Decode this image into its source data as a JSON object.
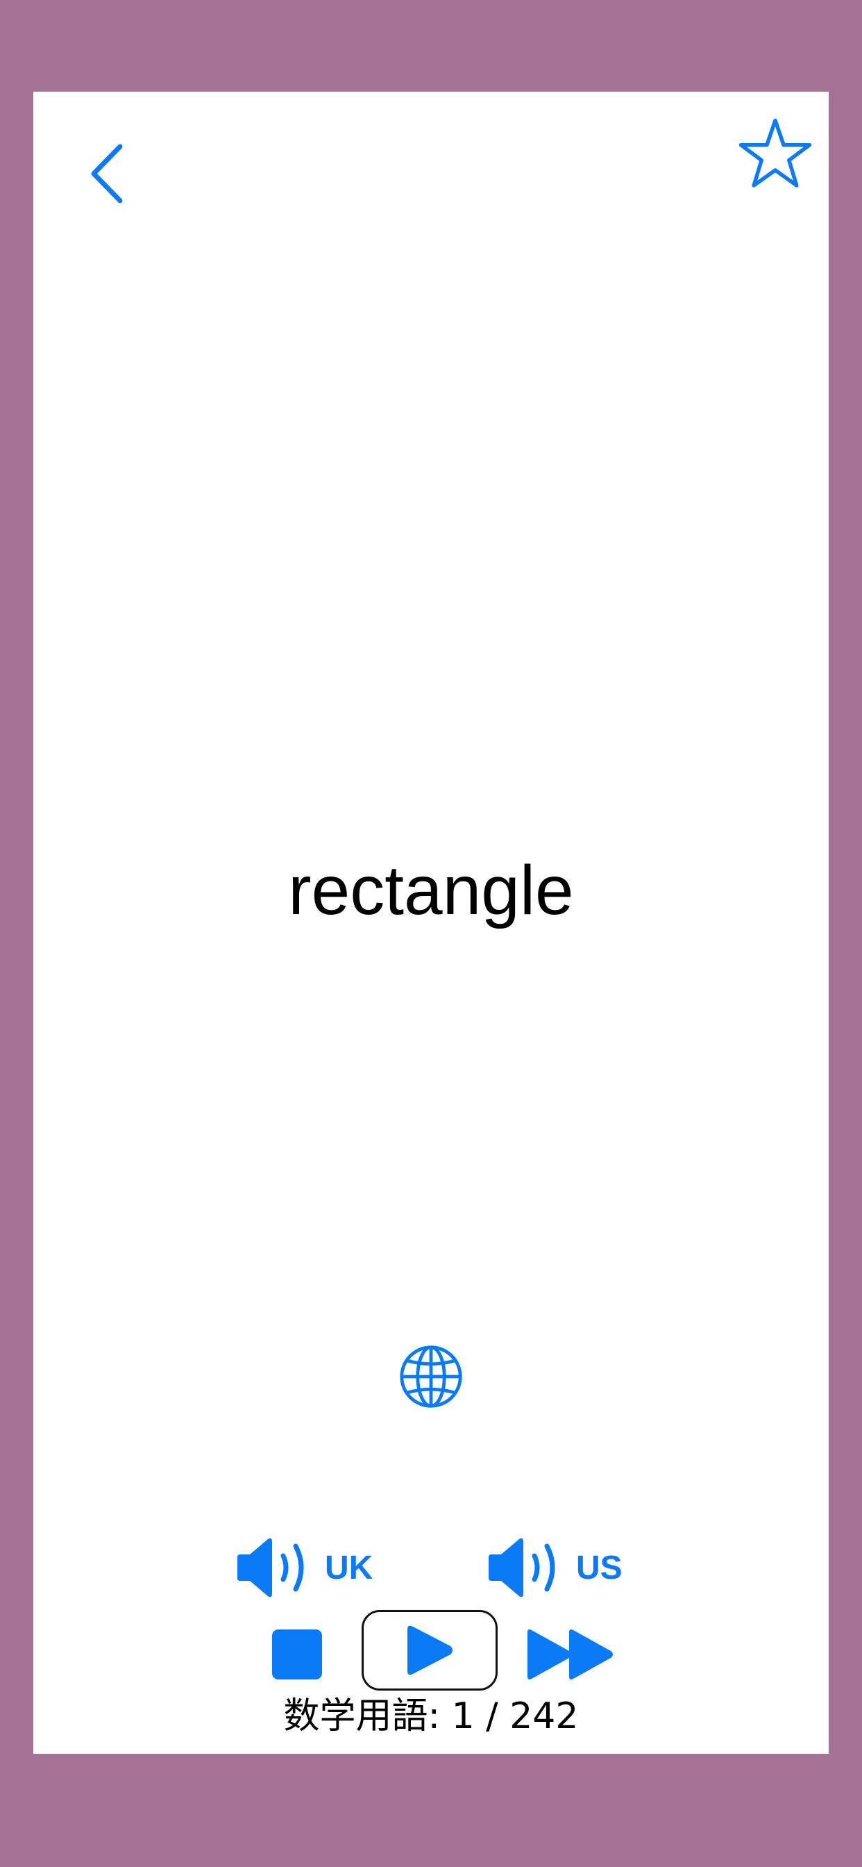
{
  "colors": {
    "background": "#a57396",
    "card": "#ffffff",
    "accent": "#0a7af6",
    "text": "#000000"
  },
  "header": {
    "back_icon": "chevron-left-icon",
    "favorite_icon": "star-outline-icon"
  },
  "card": {
    "word": "rectangle"
  },
  "translate": {
    "icon": "globe-icon"
  },
  "audio": {
    "uk_label": "UK",
    "us_label": "US",
    "speaker_icon": "speaker-icon"
  },
  "playback": {
    "stop_icon": "stop-icon",
    "play_icon": "play-icon",
    "fast_forward_icon": "fast-forward-icon"
  },
  "footer": {
    "category": "数学用語:",
    "position": "1 / 242"
  }
}
